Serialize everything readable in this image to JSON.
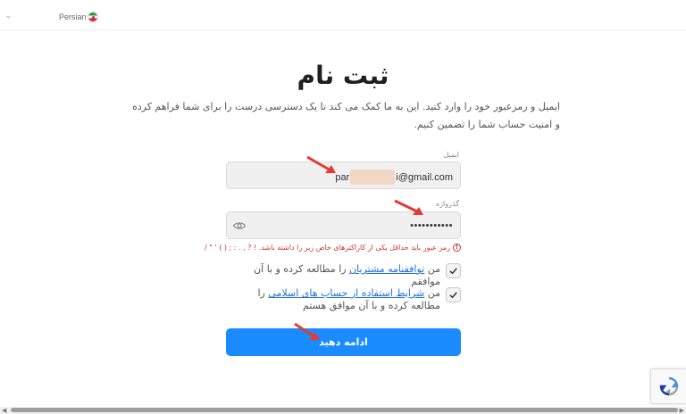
{
  "language": {
    "label": "Persian",
    "flag": "iran-flag"
  },
  "title": "ثبت نام",
  "subtitle": "ایمیل و رمزعبور خود را وارد کنید. این به ما کمک می کند تا یک دسترسی درست را برای شما فراهم کرده و امنیت حساب شما را تضمین کنیم.",
  "email": {
    "label": "ایمیل",
    "value_prefix": "par",
    "value_suffix": "i@gmail.com"
  },
  "password": {
    "label": "گذرواژه",
    "value": "•••••••••••"
  },
  "error": "رمز عبور باید حداقل یکی از کاراکترهای خاص زیر را داشته باشد. ! ? , . : ; ( ) ' \" /",
  "terms": {
    "prefix": "من ",
    "link": "توافقنامه مشتریان",
    "suffix": " را مطالعه کرده و با آن موافقم"
  },
  "islamic": {
    "prefix": "من ",
    "link": "شرایط استفاده از حساب های اسلامی",
    "suffix": " را مطالعه کرده و با آن موافق هستم"
  },
  "submit_label": "ادامه دهید",
  "colors": {
    "primary": "#1a8cff",
    "error": "#d32f2f",
    "arrow": "#e53935",
    "link": "#1d6fd8"
  }
}
